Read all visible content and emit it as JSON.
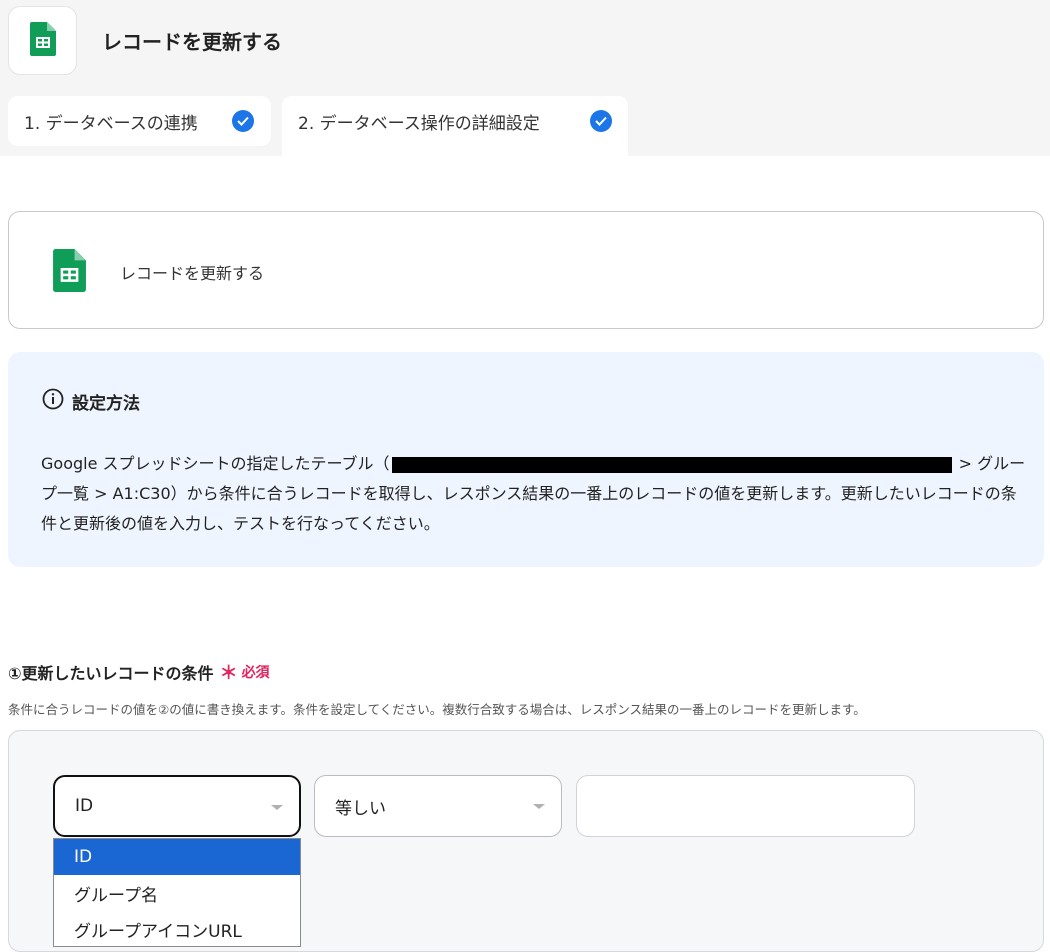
{
  "header": {
    "title": "レコードを更新する",
    "icon": "google-sheets-icon"
  },
  "tabs": [
    {
      "label": "1. データベースの連携",
      "completed": true
    },
    {
      "label": "2. データベース操作の詳細設定",
      "completed": true
    }
  ],
  "action_card": {
    "label": "レコードを更新する",
    "icon": "google-sheets-icon"
  },
  "info": {
    "title": "設定方法",
    "text_part1": "Google スプレッドシートの指定したテーブル（",
    "text_part2": " > グループ一覧 > A1:C30）から条件に合うレコードを取得し、レスポンス結果の一番上のレコードの値を更新します。更新したいレコードの条件と更新後の値を入力し、テストを行なってください。"
  },
  "condition": {
    "title": "①更新したいレコードの条件",
    "required_mark": "＊",
    "required_label": "必須",
    "description": "条件に合うレコードの値を②の値に書き換えます。条件を設定してください。複数行合致する場合は、レスポンス結果の一番上のレコードを更新します。",
    "field_value": "ID",
    "operator_value": "等しい",
    "input_value": "",
    "field_options": [
      "ID",
      "グループ名",
      "グループアイコンURL"
    ],
    "selected_option_index": 0
  },
  "colors": {
    "accent": "#1d76e8",
    "required": "#e0245e",
    "info_bg": "#eef5fe",
    "sheets_green": "#0f9d58"
  }
}
